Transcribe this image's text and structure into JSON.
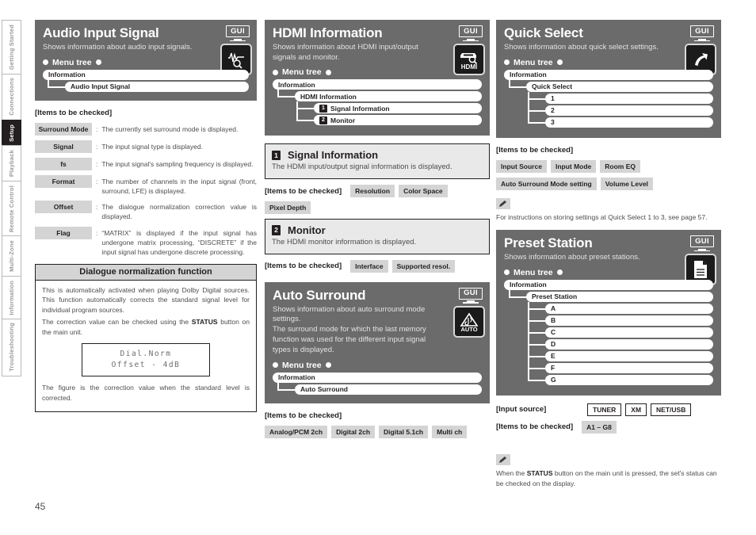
{
  "page": {
    "number": "45"
  },
  "sidebar": {
    "items": [
      {
        "label": "Getting Started",
        "active": false
      },
      {
        "label": "Connections",
        "active": false
      },
      {
        "label": "Setup",
        "active": true
      },
      {
        "label": "Playback",
        "active": false
      },
      {
        "label": "Remote Control",
        "active": false
      },
      {
        "label": "Multi-Zone",
        "active": false
      },
      {
        "label": "Information",
        "active": false
      },
      {
        "label": "Troubleshooting",
        "active": false
      }
    ]
  },
  "common": {
    "gui_badge": "GUI",
    "menu_tree_label": "Menu tree",
    "items_to_be_checked": "[Items to be checked]",
    "input_source_label": "[Input source]"
  },
  "audio_input_signal": {
    "title": "Audio Input Signal",
    "subtitle": "Shows information about audio input signals.",
    "icon": "waveform-magnifier-icon",
    "tree": [
      {
        "label": "Information",
        "level": 0
      },
      {
        "label": "Audio Input Signal",
        "level": 1
      }
    ],
    "items_head": "[Items to be checked]",
    "items": [
      {
        "key": "Surround Mode",
        "desc": "The currently set surround mode is displayed."
      },
      {
        "key": "Signal",
        "desc": "The input signal type is displayed."
      },
      {
        "key": "fs",
        "desc": "The input signal's sampling frequency is displayed."
      },
      {
        "key": "Format",
        "desc": "The number of channels in the input signal (front, surround, LFE) is displayed."
      },
      {
        "key": "Offset",
        "desc": "The dialogue normalization correction value is displayed."
      },
      {
        "key": "Flag",
        "desc": "“MATRIX” is displayed if the input signal has undergone matrix processing, “DISCRETE” if the input signal has undergone discrete processing."
      }
    ]
  },
  "dialogue_normalization": {
    "title": "Dialogue normalization function",
    "para1": "This is automatically activated when playing Dolby Digital sources. This function automatically corrects the standard signal level for individual program sources.",
    "para2_pre": "The correction value can be checked using the ",
    "para2_bold": "STATUS",
    "para2_post": " button on the main unit.",
    "lcd_line1": "Dial.Norm",
    "lcd_line2": "Offset  - 4dB",
    "para3": "The figure is the correction value when the standard level is corrected."
  },
  "hdmi_information": {
    "title": "HDMI Information",
    "subtitle": "Shows information about HDMI input/output signals and monitor.",
    "icon": "hdmi-magnifier-icon",
    "tree": [
      {
        "label": "Information",
        "level": 0,
        "num": ""
      },
      {
        "label": "HDMI Information",
        "level": 1,
        "num": ""
      },
      {
        "label": "Signal Information",
        "level": 2,
        "num": "1"
      },
      {
        "label": "Monitor",
        "level": 2,
        "num": "2"
      }
    ],
    "signal_information": {
      "num": "1",
      "title": "Signal Information",
      "desc": "The HDMI input/output signal information is displayed.",
      "items_head": "[Items to be checked]",
      "chips": [
        "Resolution",
        "Color Space",
        "Pixel Depth"
      ]
    },
    "monitor": {
      "num": "2",
      "title": "Monitor",
      "desc": "The HDMI monitor information is displayed.",
      "items_head": "[Items to be checked]",
      "chips": [
        "Interface",
        "Supported resol."
      ]
    }
  },
  "auto_surround": {
    "title": "Auto Surround",
    "subtitle": "Shows information about auto surround mode settings.\nThe surround mode for which the last memory function was used for the different input signal types is displayed.",
    "icon": "auto-surround-icon",
    "tree": [
      {
        "label": "Information",
        "level": 0
      },
      {
        "label": "Auto Surround",
        "level": 1
      }
    ],
    "items_head": "[Items to be checked]",
    "chips": [
      "Analog/PCM 2ch",
      "Digital 2ch",
      "Digital 5.1ch",
      "Multi ch"
    ]
  },
  "quick_select": {
    "title": "Quick Select",
    "subtitle": "Shows information about quick select settings.",
    "icon": "arrow-up-right-icon",
    "tree": [
      {
        "label": "Information",
        "level": 0
      },
      {
        "label": "Quick Select",
        "level": 1
      },
      {
        "label": "1",
        "level": 2
      },
      {
        "label": "2",
        "level": 2
      },
      {
        "label": "3",
        "level": 2
      }
    ],
    "items_head": "[Items to be checked]",
    "chips_row1": [
      "Input Source",
      "Input Mode",
      "Room EQ"
    ],
    "chips_row2": [
      "Auto Surround Mode setting",
      "Volume Level"
    ],
    "note": "For instructions on storing settings at Quick Select 1 to 3, see page 57."
  },
  "preset_station": {
    "title": "Preset Station",
    "subtitle": "Shows information about preset stations.",
    "icon": "document-icon",
    "tree": [
      {
        "label": "Information",
        "level": 0
      },
      {
        "label": "Preset Station",
        "level": 1
      },
      {
        "label": "A",
        "level": 2
      },
      {
        "label": "B",
        "level": 2
      },
      {
        "label": "C",
        "level": 2
      },
      {
        "label": "D",
        "level": 2
      },
      {
        "label": "E",
        "level": 2
      },
      {
        "label": "F",
        "level": 2
      },
      {
        "label": "G",
        "level": 2
      }
    ],
    "input_source_label": "[Input source]",
    "input_sources": [
      "TUNER",
      "XM",
      "NET/USB"
    ],
    "items_head": "[Items to be checked]",
    "chips": [
      "A1 – G8"
    ],
    "note_pre": "When the ",
    "note_bold": "STATUS",
    "note_post": " button on the main unit is pressed, the set's status can be checked on the display."
  }
}
